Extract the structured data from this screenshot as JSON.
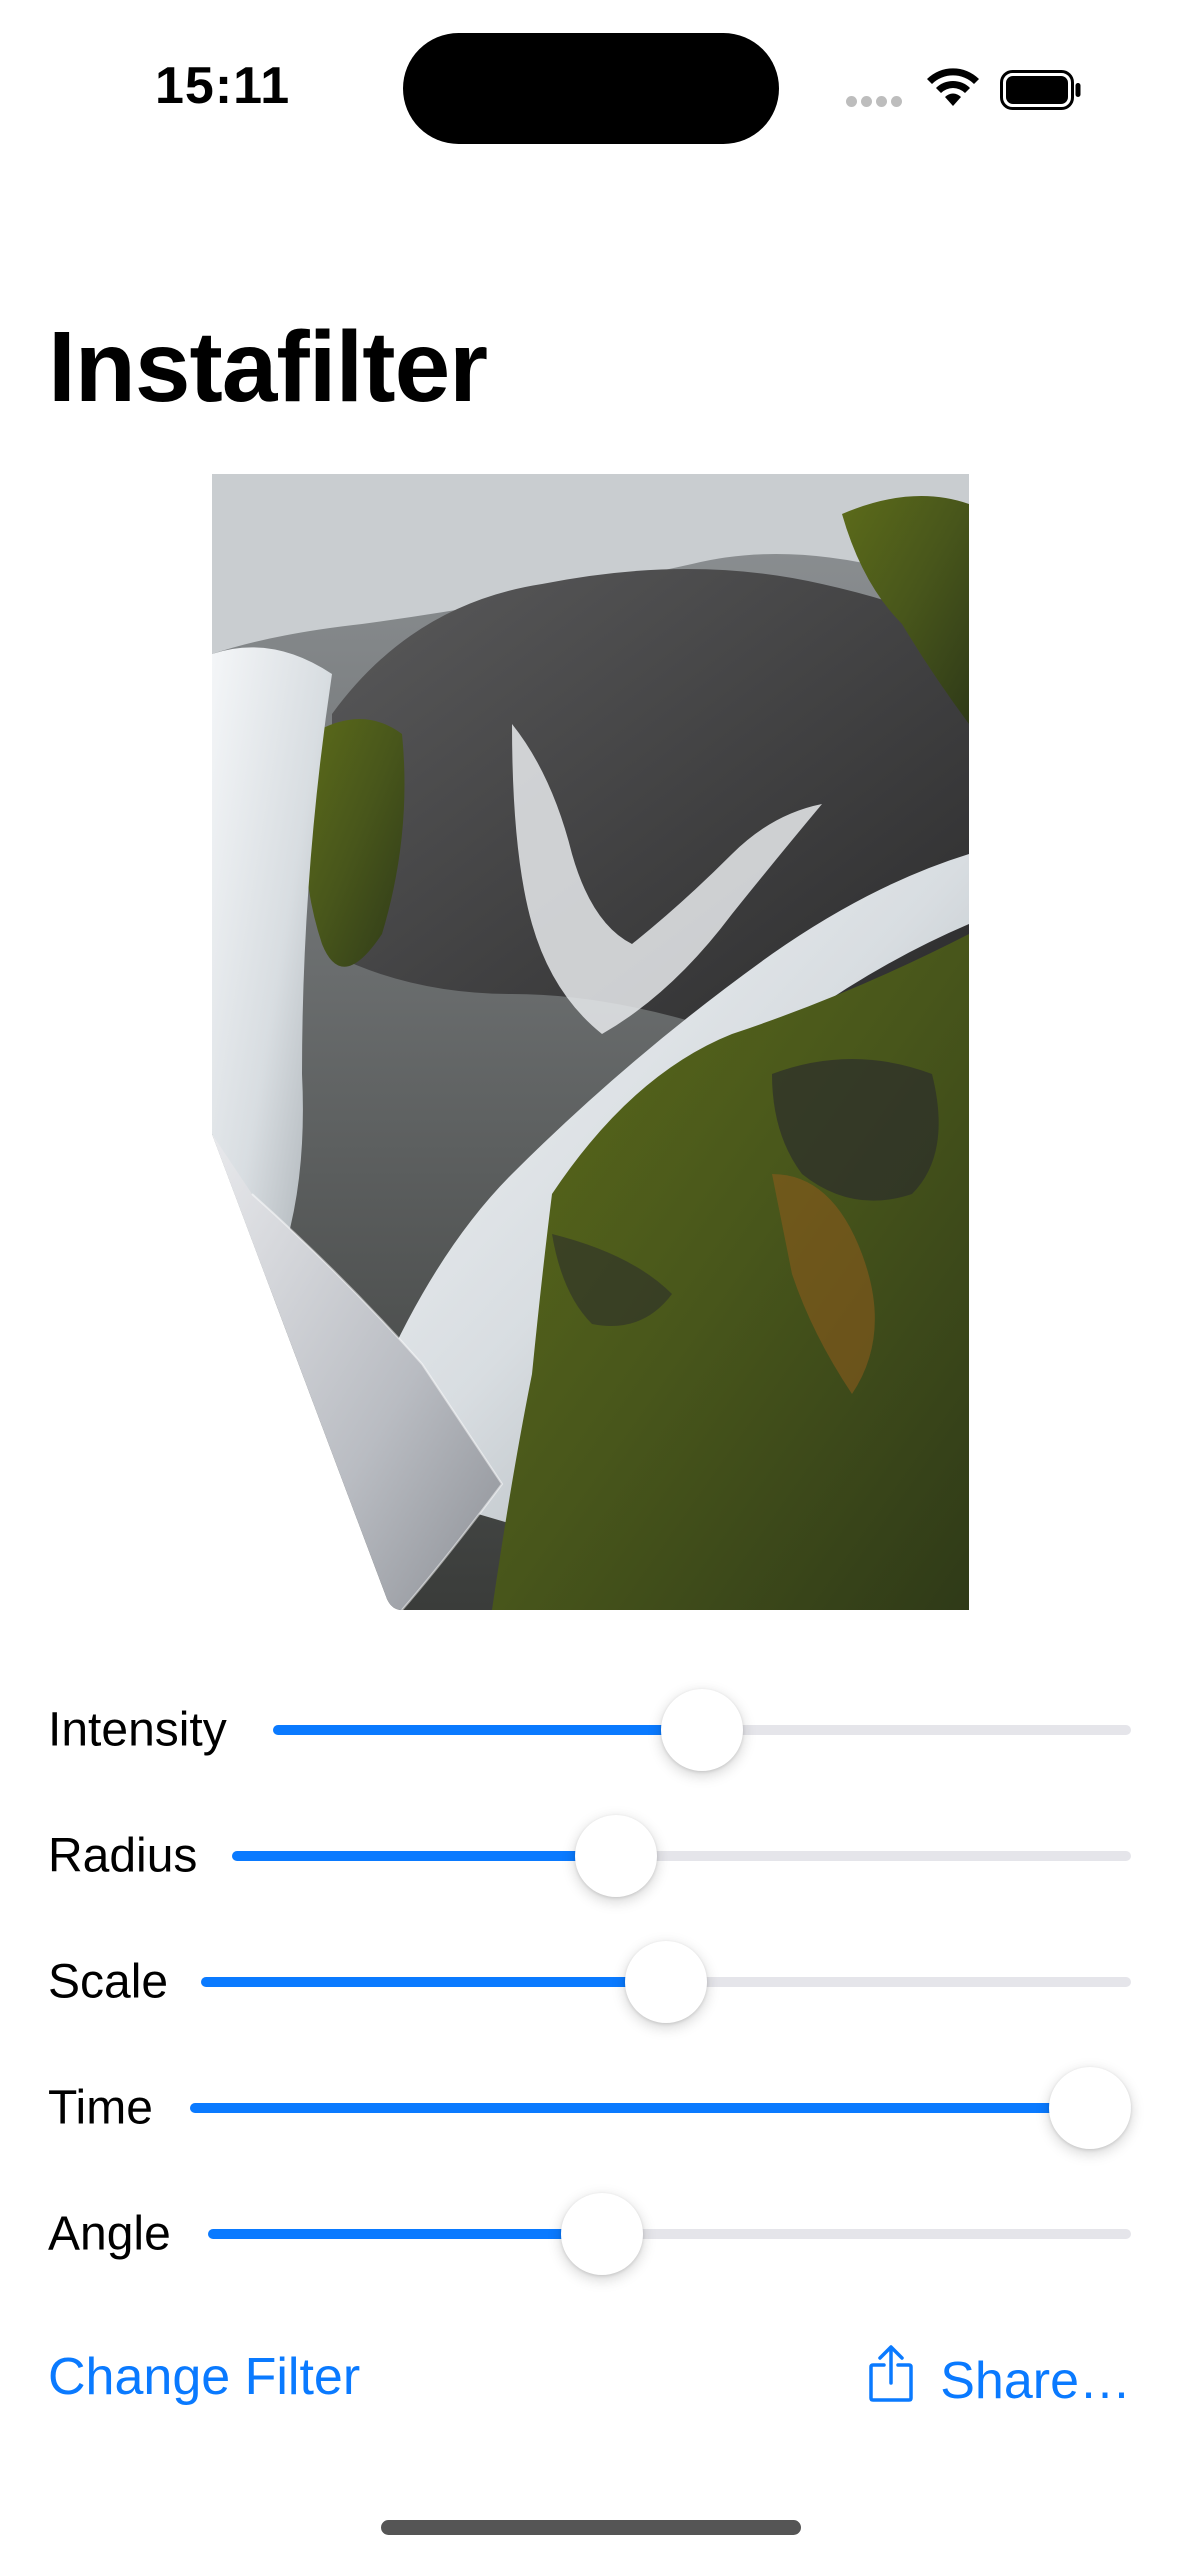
{
  "status_bar": {
    "time": "15:11"
  },
  "screen": {
    "title": "Instafilter"
  },
  "photo": {
    "subject": "waterfall over mossy rocks with page-curl filter"
  },
  "sliders": [
    {
      "label": "Intensity",
      "value": 0.5
    },
    {
      "label": "Radius",
      "value": 0.42
    },
    {
      "label": "Scale",
      "value": 0.5
    },
    {
      "label": "Time",
      "value": 1.0
    },
    {
      "label": "Angle",
      "value": 0.42
    }
  ],
  "actions": {
    "change_filter": "Change Filter",
    "share": "Share…"
  },
  "colors": {
    "accent": "#0a7aff",
    "track": "#e5e5ea"
  }
}
